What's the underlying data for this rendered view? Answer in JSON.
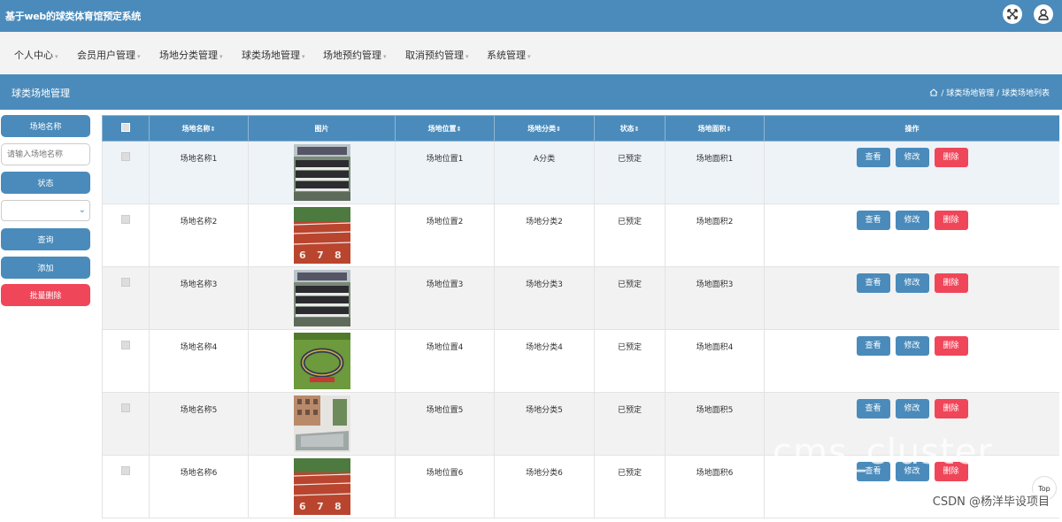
{
  "header": {
    "app_title": "基于web的球类体育馆预定系统",
    "icons": [
      "fullscreen-icon",
      "user-icon"
    ]
  },
  "menu": {
    "items": [
      "个人中心",
      "会员用户管理",
      "场地分类管理",
      "球类场地管理",
      "场地预约管理",
      "取消预约管理",
      "系统管理"
    ]
  },
  "page": {
    "title": "球类场地管理",
    "breadcrumb": "/ 球类场地管理 / 球类场地列表"
  },
  "sidebar": {
    "name_label": "场地名称",
    "name_placeholder": "请输入场地名称",
    "status_label": "状态",
    "status_value": "",
    "query_button": "查询",
    "add_button": "添加",
    "batch_delete_button": "批量删除"
  },
  "table": {
    "headers": [
      "场地名称",
      "图片",
      "场地位置",
      "场地分类",
      "状态",
      "场地面积",
      "操作"
    ],
    "sort_glyph": "⇕",
    "action_labels": {
      "view": "查看",
      "edit": "修改",
      "delete": "删除"
    },
    "rows": [
      {
        "name": "场地名称1",
        "image": "crowd-photo",
        "location": "场地位置1",
        "category": "A分类",
        "status": "已预定",
        "area": "场地面积1"
      },
      {
        "name": "场地名称2",
        "image": "running-track-photo",
        "location": "场地位置2",
        "category": "场地分类2",
        "status": "已预定",
        "area": "场地面积2"
      },
      {
        "name": "场地名称3",
        "image": "crowd-photo",
        "location": "场地位置3",
        "category": "场地分类3",
        "status": "已预定",
        "area": "场地面积3"
      },
      {
        "name": "场地名称4",
        "image": "circle-crowd-photo",
        "location": "场地位置4",
        "category": "场地分类4",
        "status": "已预定",
        "area": "场地面积4"
      },
      {
        "name": "场地名称5",
        "image": "court-building-photo",
        "location": "场地位置5",
        "category": "场地分类5",
        "status": "已预定",
        "area": "场地面积5"
      },
      {
        "name": "场地名称6",
        "image": "running-track-photo",
        "location": "场地位置6",
        "category": "场地分类6",
        "status": "已预定",
        "area": "场地面积6"
      }
    ]
  },
  "overlay": {
    "watermark": "cms_cluster",
    "source": "CSDN @杨洋毕设项目",
    "top_button": "Top"
  },
  "colors": {
    "primary": "#4a8bbb",
    "danger": "#f0465a",
    "menu_bg": "#f3f3f3"
  }
}
